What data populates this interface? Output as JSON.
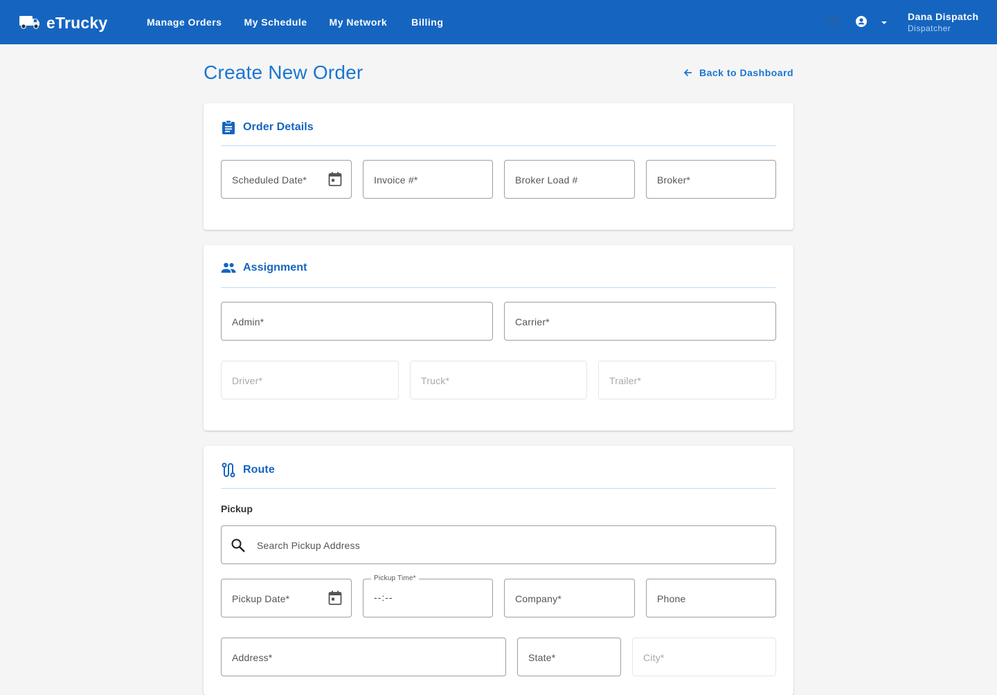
{
  "app": {
    "name": "eTrucky"
  },
  "nav": {
    "items": [
      {
        "label": "Manage Orders"
      },
      {
        "label": "My Schedule"
      },
      {
        "label": "My Network"
      },
      {
        "label": "Billing"
      }
    ]
  },
  "user": {
    "name": "Dana Dispatch",
    "role": "Dispatcher"
  },
  "page": {
    "title": "Create New Order",
    "back_label": "Back to Dashboard"
  },
  "order_details": {
    "title": "Order Details",
    "fields": {
      "scheduled_date": "Scheduled Date*",
      "invoice": "Invoice #*",
      "broker_load": "Broker Load #",
      "broker": "Broker*"
    }
  },
  "assignment": {
    "title": "Assignment",
    "fields": {
      "admin": "Admin*",
      "carrier": "Carrier*",
      "driver": "Driver*",
      "truck": "Truck*",
      "trailer": "Trailer*"
    }
  },
  "route": {
    "title": "Route",
    "pickup_heading": "Pickup",
    "fields": {
      "search": "Search Pickup Address",
      "pickup_date": "Pickup Date*",
      "pickup_time_label": "Pickup Time*",
      "pickup_time_value": "--:--",
      "company": "Company*",
      "phone": "Phone",
      "address": "Address*",
      "state": "State*",
      "city": "City*"
    }
  },
  "colors": {
    "primary": "#1565c0",
    "accent": "#1976d2",
    "divider": "#bbdefb"
  }
}
